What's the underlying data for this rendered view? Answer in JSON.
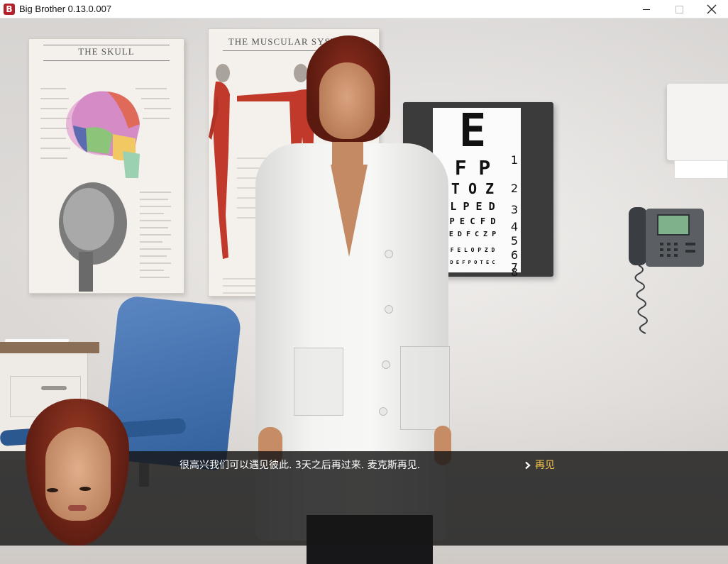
{
  "window": {
    "title": "Big Brother 0.13.0.007",
    "icon_letter": "B"
  },
  "scene": {
    "poster_left_title": "THE SKULL",
    "poster_right_title": "THE MUSCULAR SYSTEM",
    "eye_chart": {
      "rows": [
        "E",
        "F P",
        "T O Z",
        "L P E D",
        "P E C F D",
        "E D F C Z P",
        "F E L O P Z D",
        "D E F P O T E C"
      ],
      "numbers": [
        "1",
        "2",
        "3",
        "4",
        "5",
        "6",
        "7",
        "8"
      ]
    }
  },
  "dialogue": {
    "text": "很高兴我们可以遇见彼此. 3天之后再过来. 麦克斯再见.",
    "choice_label": "再见"
  },
  "colors": {
    "dialogue_bg": "#161616",
    "choice_text": "#f1c24a",
    "app_icon": "#b3212a"
  }
}
